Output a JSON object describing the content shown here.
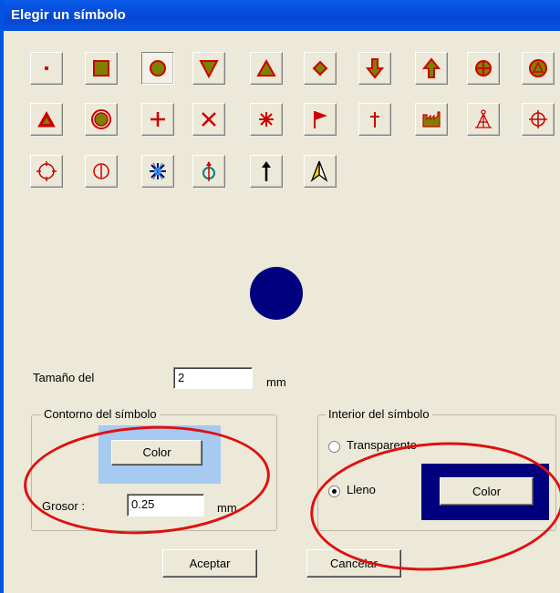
{
  "window": {
    "title": "Elegir un símbolo"
  },
  "symbols": [
    {
      "icon": "small-dot-icon",
      "selected": false
    },
    {
      "icon": "square-icon",
      "selected": false
    },
    {
      "icon": "circle-icon",
      "selected": true
    },
    {
      "icon": "triangle-down-icon",
      "selected": false
    },
    {
      "icon": "triangle-up-icon",
      "selected": false
    },
    {
      "icon": "diamond-icon",
      "selected": false
    },
    {
      "icon": "arrow-down-icon",
      "selected": false
    },
    {
      "icon": "arrow-up-icon",
      "selected": false
    },
    {
      "icon": "circle-cross-icon",
      "selected": false
    },
    {
      "icon": "circle-triangle-icon",
      "selected": false
    },
    {
      "icon": "red-triangle-icon",
      "selected": false
    },
    {
      "icon": "double-circle-icon",
      "selected": false
    },
    {
      "icon": "plus-icon",
      "selected": false
    },
    {
      "icon": "x-mark-icon",
      "selected": false
    },
    {
      "icon": "asterisk-icon",
      "selected": false
    },
    {
      "icon": "flag-icon",
      "selected": false
    },
    {
      "icon": "dagger-icon",
      "selected": false
    },
    {
      "icon": "factory-icon",
      "selected": false
    },
    {
      "icon": "tower-icon",
      "selected": false
    },
    {
      "icon": "crosshair-icon",
      "selected": false
    },
    {
      "icon": "target-ticks-icon",
      "selected": false
    },
    {
      "icon": "circle-bar-icon",
      "selected": false
    },
    {
      "icon": "snowflake-icon",
      "selected": false
    },
    {
      "icon": "compass-marker-icon",
      "selected": false
    },
    {
      "icon": "north-arrow-icon",
      "selected": false
    },
    {
      "icon": "navigation-arrow-icon",
      "selected": false
    }
  ],
  "preview": {
    "color": "#00007f",
    "icon": "circle-icon"
  },
  "size": {
    "label": "Tamaño del",
    "value": "2",
    "unit": "mm"
  },
  "outline": {
    "title": "Contorno del símbolo",
    "color_button": "Color",
    "color_swatch": "#a6caf0",
    "thickness_label": "Grosor :",
    "thickness_value": "0.25",
    "thickness_unit": "mm"
  },
  "fill": {
    "title": "Interior del símbolo",
    "option_transparent": "Transparente",
    "option_filled": "Lleno",
    "selected": "Lleno",
    "color_button": "Color",
    "color_swatch": "#00007f"
  },
  "buttons": {
    "accept": "Aceptar",
    "cancel": "Cancelar"
  },
  "colors": {
    "highlight_ellipse": "#e01010",
    "title_bar": "#0546d4"
  }
}
